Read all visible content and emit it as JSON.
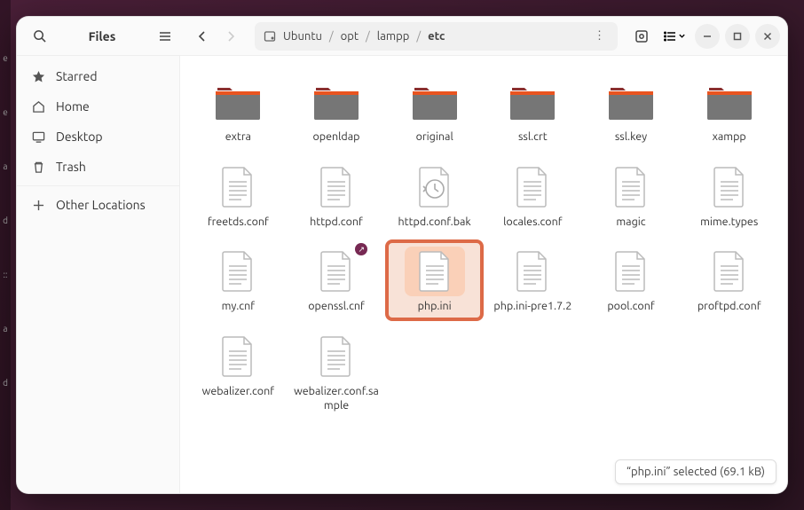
{
  "app_title": "Files",
  "breadcrumb": {
    "root_icon": "disk",
    "parts": [
      "Ubuntu",
      "opt",
      "lampp",
      "etc"
    ]
  },
  "sidebar": {
    "items": [
      {
        "icon": "star",
        "label": "Starred"
      },
      {
        "icon": "home",
        "label": "Home"
      },
      {
        "icon": "desktop",
        "label": "Desktop"
      },
      {
        "icon": "trash",
        "label": "Trash"
      }
    ],
    "other_locations_label": "Other Locations"
  },
  "items": [
    {
      "type": "folder",
      "label": "extra"
    },
    {
      "type": "folder",
      "label": "openldap"
    },
    {
      "type": "folder",
      "label": "original"
    },
    {
      "type": "folder",
      "label": "ssl.crt"
    },
    {
      "type": "folder",
      "label": "ssl.key"
    },
    {
      "type": "folder",
      "label": "xampp"
    },
    {
      "type": "file",
      "label": "freetds.conf"
    },
    {
      "type": "file",
      "label": "httpd.conf"
    },
    {
      "type": "file-recent",
      "label": "httpd.conf.bak"
    },
    {
      "type": "file",
      "label": "locales.conf"
    },
    {
      "type": "file",
      "label": "magic"
    },
    {
      "type": "file",
      "label": "mime.types"
    },
    {
      "type": "file",
      "label": "my.cnf"
    },
    {
      "type": "file",
      "label": "openssl.cnf",
      "emblem": "link"
    },
    {
      "type": "file",
      "label": "php.ini",
      "selected": true
    },
    {
      "type": "file",
      "label": "php.ini-pre1.7.2"
    },
    {
      "type": "file",
      "label": "pool.conf"
    },
    {
      "type": "file",
      "label": "proftpd.conf"
    },
    {
      "type": "file",
      "label": "webalizer.conf"
    },
    {
      "type": "file",
      "label": "webalizer.conf.sample"
    }
  ],
  "status": {
    "text": "“php.ini” selected  (69.1 kB)"
  }
}
